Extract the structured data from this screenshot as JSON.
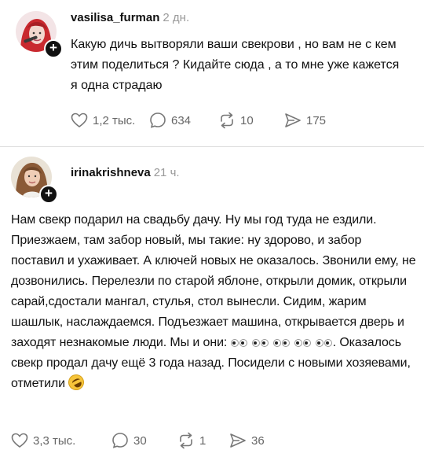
{
  "posts": [
    {
      "username": "vasilisa_furman",
      "time": "2 дн.",
      "avatar": "woman-red-hair-avatar",
      "follow_icon": "+",
      "text": "Какую дичь вытворяли ваши свекрови , но вам не с кем этим поделиться ? Кидайте сюда , а то мне уже кажется я одна страдаю",
      "actions": {
        "likes": "1,2 тыс.",
        "comments": "634",
        "reposts": "10",
        "shares": "175"
      }
    },
    {
      "username": "irinakrishneva",
      "time": "21 ч.",
      "avatar": "woman-photo-avatar",
      "follow_icon": "+",
      "text_part1": "Нам свекр подарил на свадьбу дачу. Ну мы год туда не ездили. Приезжаем, там забор новый, мы такие: ну здорово, и забор поставил и ухаживает. А ключей новых не оказалось. Звонили ему, не дозвонились. Перелезли по старой яблоне, открыли домик, открыли сарай,сдостали мангал, стулья, стол вынесли. Сидим, жарим шашлык, наслаждаемся. Подъезжает машина, открывается дверь и заходят незнакомые люди. Мы и они:",
      "text_emoji1": "eyes-emoji x5",
      "text_part2": ". Оказалось свекр продал дачу ещё 3 года назад. Посидели с новыми хозяевами, отметили",
      "text_emoji2": "rofl-emoji",
      "actions": {
        "likes": "3,3 тыс.",
        "comments": "30",
        "reposts": "1",
        "shares": "36"
      }
    }
  ]
}
